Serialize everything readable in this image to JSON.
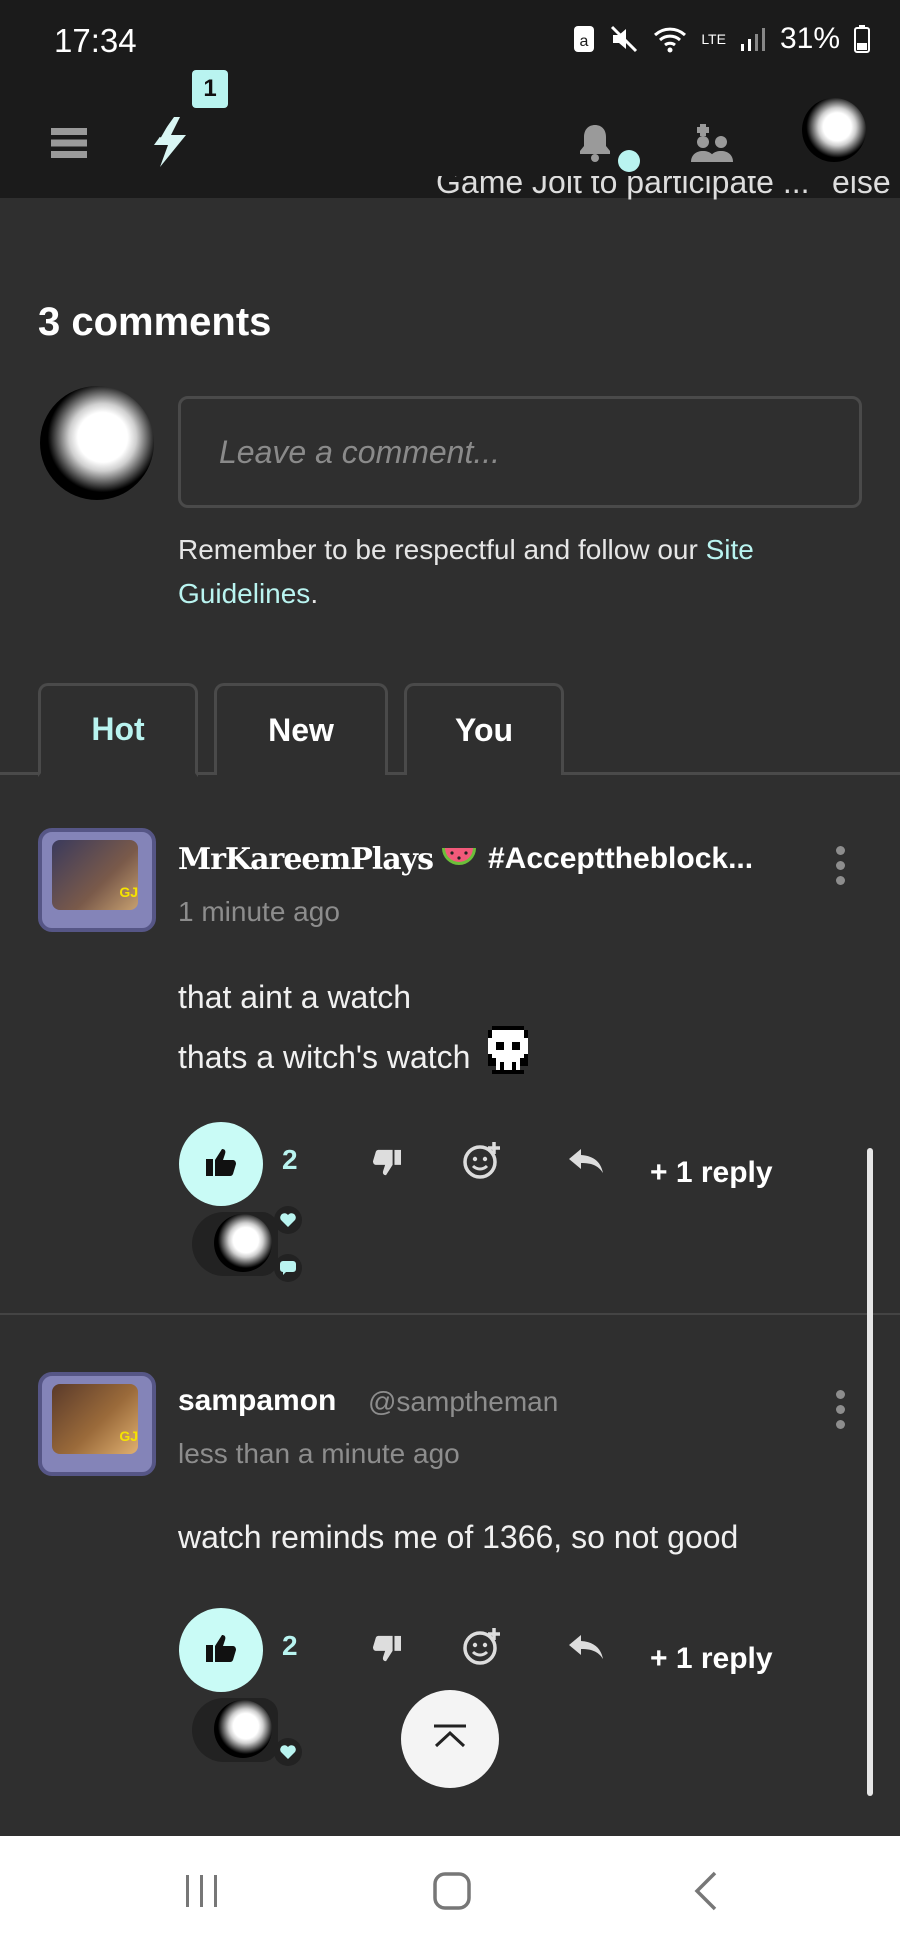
{
  "status_bar": {
    "time": "17:34",
    "battery": "31%",
    "network": "LTE"
  },
  "nav": {
    "badge_count": "1",
    "icons": [
      "menu-icon",
      "bolt-icon",
      "bell-icon",
      "friends-icon",
      "avatar"
    ]
  },
  "cutoff": {
    "left": "Game Jolt to participate ...",
    "right": "else"
  },
  "comments": {
    "title": "3 comments",
    "input_placeholder": "Leave a comment...",
    "guidelines_prefix": "Remember to be respectful and follow our ",
    "guidelines_link": "Site Guidelines",
    "guidelines_suffix": "."
  },
  "tabs": [
    {
      "label": "Hot"
    },
    {
      "label": "New"
    },
    {
      "label": "You"
    }
  ],
  "items": [
    {
      "author": "MrKareemPlays",
      "extra": "#Accepttheblock...",
      "time": "1 minute ago",
      "line1": "that aint a watch",
      "line2": "thats a witch's watch",
      "likes": "2",
      "replies": "+ 1 reply"
    },
    {
      "author": "sampamon",
      "handle": "@samptheman",
      "time": "less than a minute ago",
      "line1": "watch reminds me of 1366, so not good",
      "likes": "2",
      "replies": "+ 1 reply"
    }
  ],
  "colors": {
    "accent": "#b9f4f0",
    "background": "#2f2f2f",
    "header": "#1b1b1b"
  }
}
